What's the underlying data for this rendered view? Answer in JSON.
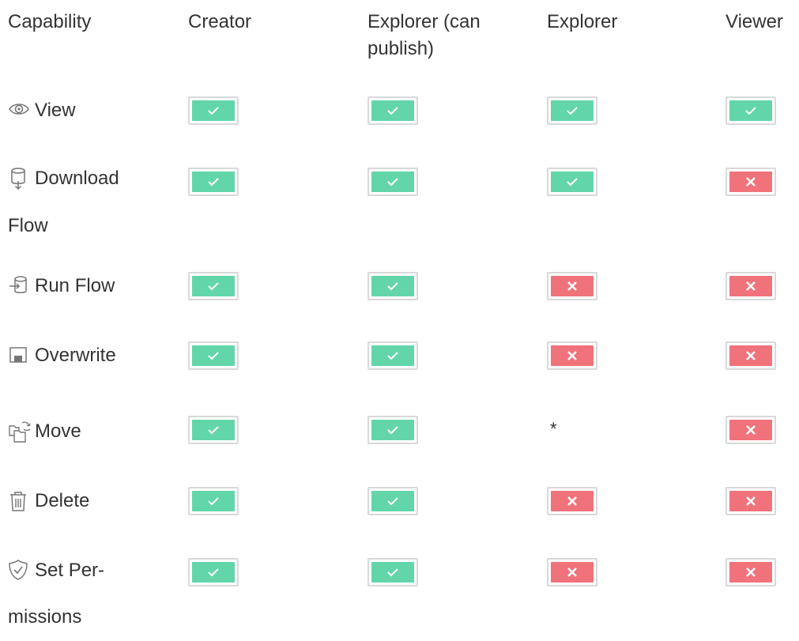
{
  "headers": [
    "Capability",
    "Creator",
    "Explorer (can publish)",
    "Explorer",
    "Viewer"
  ],
  "rows": [
    {
      "label": "View",
      "icon": "eye-icon",
      "values": [
        "yes",
        "yes",
        "yes",
        "yes"
      ]
    },
    {
      "label": "Download Flow",
      "icon": "download-database-icon",
      "values": [
        "yes",
        "yes",
        "yes",
        "no"
      ]
    },
    {
      "label": "Run Flow",
      "icon": "run-flow-database-icon",
      "values": [
        "yes",
        "yes",
        "no",
        "no"
      ]
    },
    {
      "label": "Overwrite",
      "icon": "overwrite-save-icon",
      "values": [
        "yes",
        "yes",
        "no",
        "no"
      ]
    },
    {
      "label": "Move",
      "icon": "move-folders-icon",
      "values": [
        "yes",
        "yes",
        "*",
        "no"
      ]
    },
    {
      "label": "Delete",
      "icon": "trash-icon",
      "values": [
        "yes",
        "yes",
        "no",
        "no"
      ]
    },
    {
      "label": "Set Per-missions",
      "icon": "shield-check-icon",
      "values": [
        "yes",
        "yes",
        "no",
        "no"
      ]
    }
  ],
  "colors": {
    "allowed": "#62d6a9",
    "denied": "#f0727b",
    "badge_border": "#d9d9d9",
    "text": "#333333"
  }
}
